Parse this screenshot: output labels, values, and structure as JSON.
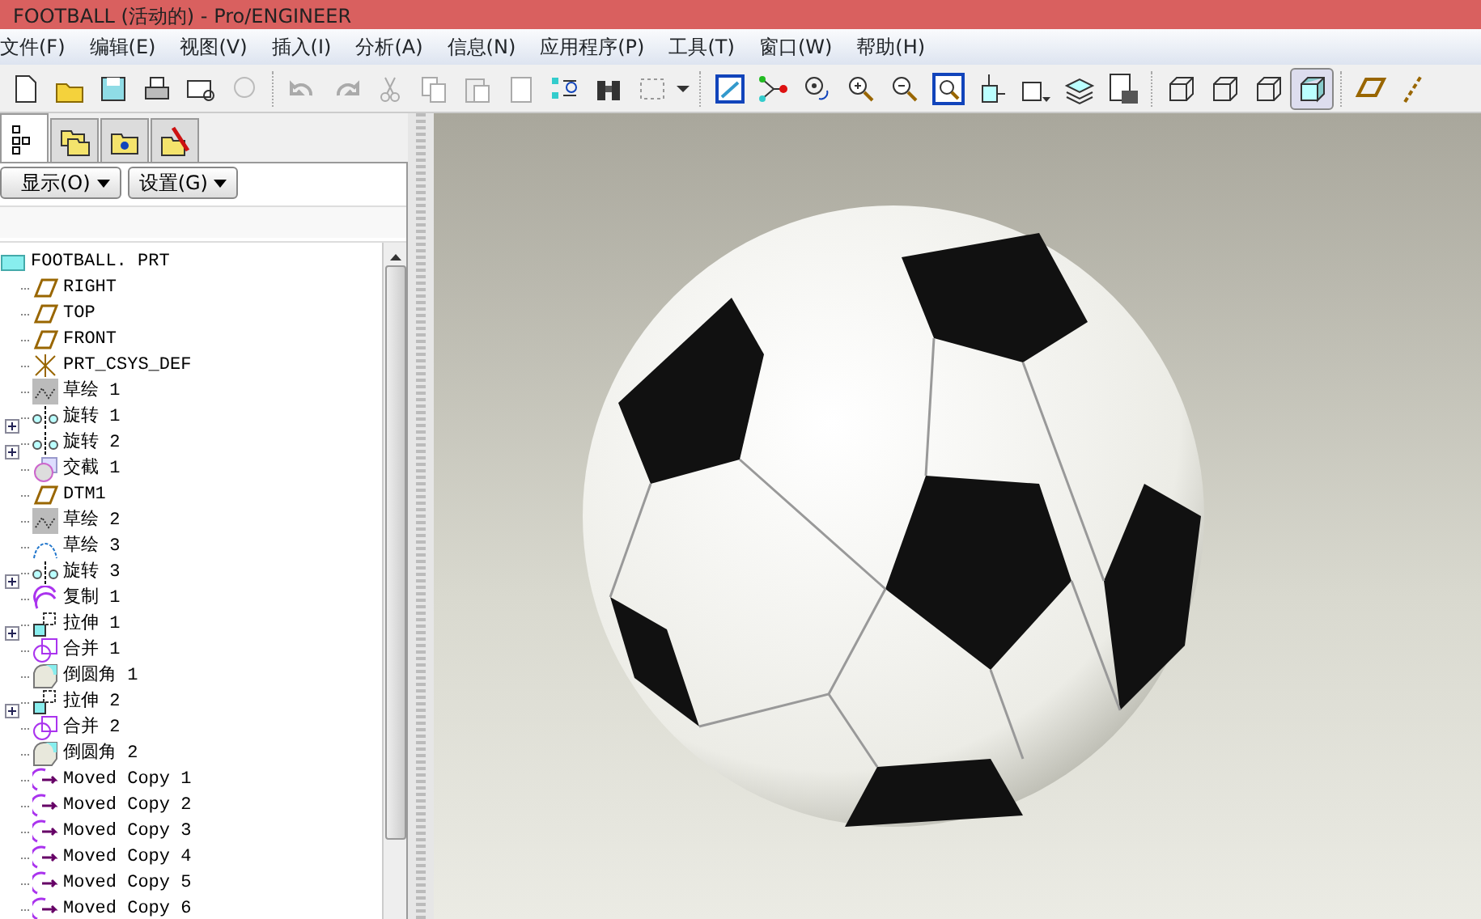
{
  "window": {
    "title": "FOOTBALL (活动的) - Pro/ENGINEER"
  },
  "menu": [
    "文件(F)",
    "编辑(E)",
    "视图(V)",
    "插入(I)",
    "分析(A)",
    "信息(N)",
    "应用程序(P)",
    "工具(T)",
    "窗口(W)",
    "帮助(H)"
  ],
  "display_styles": [
    {
      "selected": false
    },
    {
      "selected": false
    },
    {
      "selected": false
    },
    {
      "selected": true
    }
  ],
  "panel_tabs": [
    {
      "selected": true
    },
    {
      "selected": false
    },
    {
      "selected": false
    },
    {
      "selected": false
    }
  ],
  "panel_buttons": [
    "显示(O)",
    "设置(G)"
  ],
  "tree": {
    "root": "FOOTBALL. PRT",
    "items": [
      {
        "kind": "plane",
        "label": "RIGHT",
        "collapsed": false
      },
      {
        "kind": "plane",
        "label": "TOP",
        "collapsed": false
      },
      {
        "kind": "plane",
        "label": "FRONT",
        "collapsed": false
      },
      {
        "kind": "csys",
        "label": "PRT_CSYS_DEF",
        "collapsed": false
      },
      {
        "kind": "sketch",
        "label": "草绘 1",
        "collapsed": false
      },
      {
        "kind": "revolve",
        "label": "旋转 1",
        "collapsed": true
      },
      {
        "kind": "revolve",
        "label": "旋转 2",
        "collapsed": true
      },
      {
        "kind": "intersect",
        "label": "交截 1",
        "collapsed": false
      },
      {
        "kind": "plane",
        "label": "DTM1",
        "collapsed": false
      },
      {
        "kind": "sketch",
        "label": "草绘 2",
        "collapsed": false
      },
      {
        "kind": "curve",
        "label": "草绘 3",
        "collapsed": false
      },
      {
        "kind": "revolve",
        "label": "旋转 3",
        "collapsed": true
      },
      {
        "kind": "copy",
        "label": "复制 1",
        "collapsed": false
      },
      {
        "kind": "extrude",
        "label": "拉伸 1",
        "collapsed": true
      },
      {
        "kind": "merge",
        "label": "合并 1",
        "collapsed": false
      },
      {
        "kind": "round",
        "label": "倒圆角 1",
        "collapsed": false
      },
      {
        "kind": "extrude",
        "label": "拉伸 2",
        "collapsed": true
      },
      {
        "kind": "merge",
        "label": "合并 2",
        "collapsed": false
      },
      {
        "kind": "round",
        "label": "倒圆角 2",
        "collapsed": false
      },
      {
        "kind": "moved",
        "label": "Moved Copy 1",
        "collapsed": false
      },
      {
        "kind": "moved",
        "label": "Moved Copy 2",
        "collapsed": false
      },
      {
        "kind": "moved",
        "label": "Moved Copy 3",
        "collapsed": false
      },
      {
        "kind": "moved",
        "label": "Moved Copy 4",
        "collapsed": false
      },
      {
        "kind": "moved",
        "label": "Moved Copy 5",
        "collapsed": false
      },
      {
        "kind": "moved",
        "label": "Moved Copy 6",
        "collapsed": false
      }
    ]
  }
}
